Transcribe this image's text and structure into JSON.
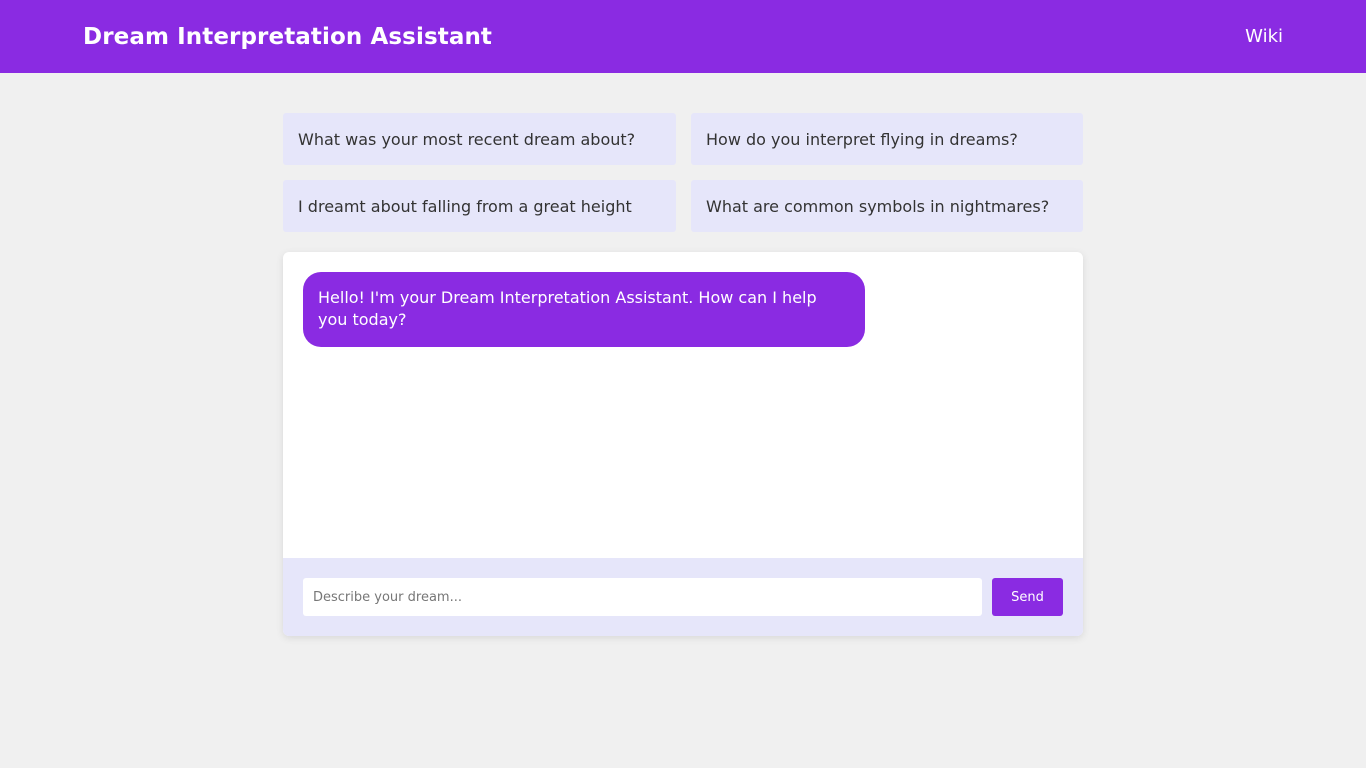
{
  "header": {
    "title": "Dream Interpretation Assistant",
    "wiki_link": "Wiki"
  },
  "suggestions": [
    "What was your most recent dream about?",
    "How do you interpret flying in dreams?",
    "I dreamt about falling from a great height",
    "What are common symbols in nightmares?"
  ],
  "chat": {
    "messages": [
      {
        "sender": "bot",
        "text": "Hello! I'm your Dream Interpretation Assistant. How can I help you today?"
      }
    ],
    "input_placeholder": "Describe your dream...",
    "input_value": "",
    "send_label": "Send"
  },
  "colors": {
    "accent": "#8a2be2",
    "suggestion_bg": "#e6e6fa",
    "page_bg": "#f0f0f0"
  }
}
